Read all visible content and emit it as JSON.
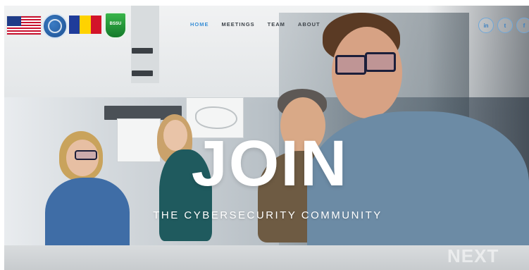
{
  "nav": {
    "items": [
      {
        "label": "HOME",
        "active": true
      },
      {
        "label": "MEETINGS",
        "active": false
      },
      {
        "label": "TEAM",
        "active": false
      },
      {
        "label": "ABOUT",
        "active": false
      }
    ]
  },
  "social": [
    {
      "icon": "linkedin-icon",
      "glyph": "in"
    },
    {
      "icon": "twitter-icon",
      "glyph": "t"
    },
    {
      "icon": "facebook-icon",
      "glyph": "f"
    }
  ],
  "logos": {
    "shield_text": "BSSU"
  },
  "hero": {
    "title": "JOIN",
    "subtitle": "THE CYBERSECURITY COMMUNITY"
  },
  "slider": {
    "next_label": "NEXT"
  },
  "colors": {
    "nav_active": "#3a8fd6",
    "nav_text": "#3c4248",
    "hero_text": "#ffffff"
  }
}
